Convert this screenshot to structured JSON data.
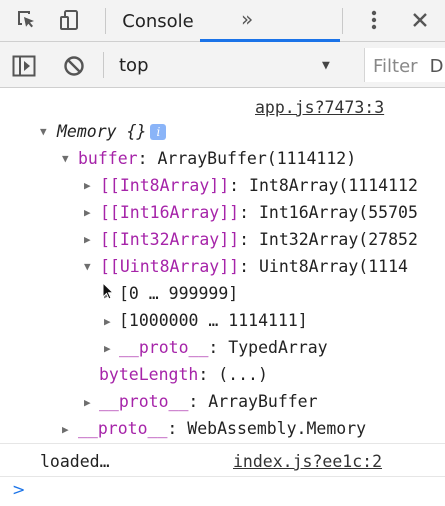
{
  "toolbar": {
    "icons": [
      "inspect-element-icon",
      "device-toolbar-icon",
      "more-tabs-icon",
      "kebab-menu-icon",
      "close-icon"
    ],
    "tab_console": "Console",
    "more_tabs": "»"
  },
  "console_bar": {
    "icons": [
      "sidebar-toggle-icon",
      "clear-console-icon"
    ],
    "context": "top",
    "filter_placeholder": "Filter",
    "filter_cut": "D"
  },
  "log": {
    "source1": "app.js?7473:3",
    "memory_label": "Memory {}",
    "buffer_key": "buffer",
    "buffer_value": "ArrayBuffer(1114112)",
    "int8_key": "[[Int8Array]]",
    "int8_value": "Int8Array(1114112",
    "int16_key": "[[Int16Array]]",
    "int16_value": "Int16Array(55705",
    "int32_key": "[[Int32Array]]",
    "int32_value": "Int32Array(27852",
    "uint8_key": "[[Uint8Array]]",
    "uint8_value": "Uint8Array(1114",
    "range1": "[0 … 999999]",
    "range2": "[1000000 … 1114111]",
    "proto_key": "__proto__",
    "typed_array": "TypedArray",
    "bytelength_key": "byteLength",
    "bytelength_value": "(...)",
    "array_buffer": "ArrayBuffer",
    "wasm_memory": "WebAssembly.Memory",
    "loaded": "loaded…",
    "source2": "index.js?ee1c:2",
    "prompt": ">"
  },
  "colors": {
    "accent": "#1a73e8",
    "purple_key": "#a624a9",
    "info_badge": "#8ab4f8"
  }
}
